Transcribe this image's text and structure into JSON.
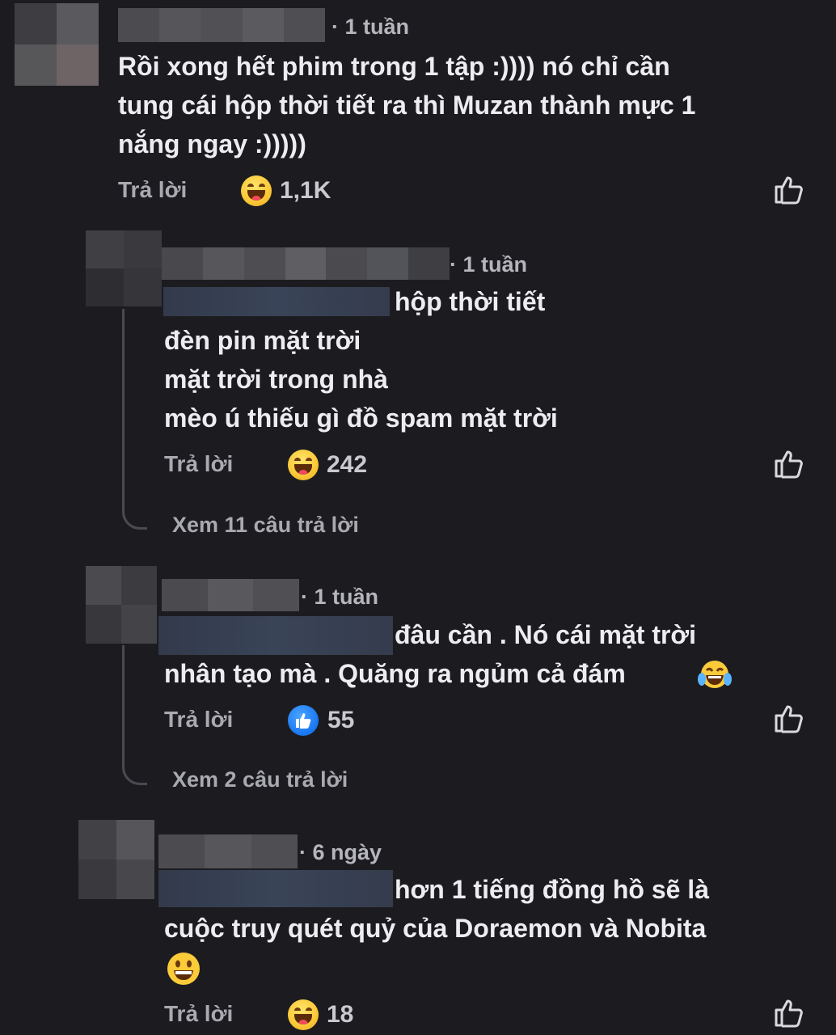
{
  "colors": {
    "background": "#1c1c20",
    "text": "#ececf0",
    "muted": "#a9a9b0",
    "like_blue": "#1877f2",
    "haha_yellow": "#fbcb3a"
  },
  "comments": [
    {
      "time": "· 1 tuần",
      "lines": [
        "Rồi xong hết phim trong 1 tập :)))) nó chỉ cần",
        "tung cái hộp thời tiết ra thì Muzan thành mực 1",
        "nắng ngay :)))))"
      ],
      "reply_label": "Trả lời",
      "reaction_icon": "haha-emoji",
      "reaction_count": "1,1K"
    },
    {
      "time": "· 1 tuần",
      "lines": [
        "hộp thời tiết",
        "đèn pin mặt trời",
        "mặt trời trong nhà",
        "mèo ú thiếu gì đồ spam mặt trời"
      ],
      "reply_label": "Trả lời",
      "reaction_icon": "haha-emoji",
      "reaction_count": "242",
      "view_replies": "Xem 11 câu trả lời"
    },
    {
      "time": "· 1 tuần",
      "lines": [
        "đâu cần . Nó cái mặt trời",
        "nhân tạo mà . Quăng ra ngủm cả đám"
      ],
      "inline_emoji": "laughing-tears-emoji",
      "reply_label": "Trả lời",
      "reaction_icon": "like-reaction",
      "reaction_count": "55",
      "view_replies": "Xem 2 câu trả lời"
    },
    {
      "time": "· 6 ngày",
      "lines": [
        "hơn 1 tiếng đồng hồ sẽ là",
        "cuộc truy quét quỷ của Doraemon và Nobita"
      ],
      "inline_emoji": "grinning-emoji",
      "reply_label": "Trả lời",
      "reaction_icon": "haha-emoji",
      "reaction_count": "18"
    }
  ]
}
